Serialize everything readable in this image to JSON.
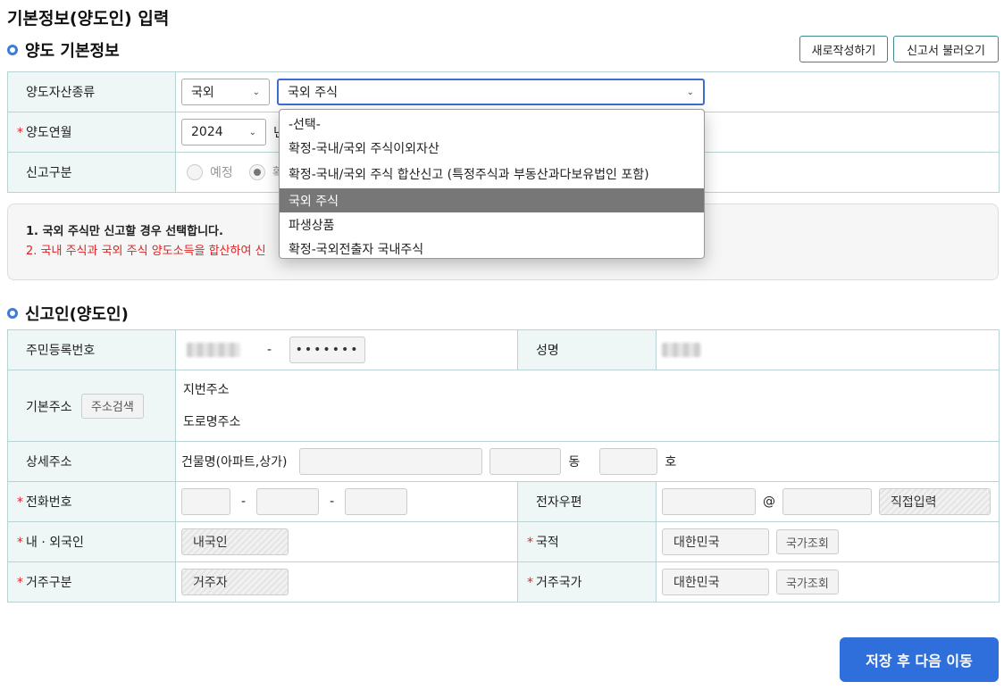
{
  "page_title": "기본정보(양도인) 입력",
  "section1": {
    "title": "양도 기본정보",
    "new_button": "새로작성하기",
    "load_button": "신고서 불러오기",
    "rows": {
      "asset_type_label": "양도자산종류",
      "asset_scope_value": "국외",
      "asset_kind_value": "국외 주식",
      "date_label": "양도연월",
      "year_value": "2024",
      "year_suffix": "년",
      "report_type_label": "신고구분",
      "radio_prelim": "예정",
      "radio_final": "확"
    }
  },
  "dropdown": {
    "options": [
      "-선택-",
      "확정-국내/국외 주식이외자산",
      "확정-국내/국외 주식 합산신고 (특정주식과 부동산과다보유법인 포함)",
      "국외 주식",
      "파생상품",
      "확정-국외전출자 국내주식"
    ],
    "selected_index": 3
  },
  "notice": {
    "line1": "1. 국외 주식만 신고할 경우 선택합니다.",
    "line2_start": "2. 국내 주식과 국외 주식 양도소득을 합산하여 신",
    "line2_end": "."
  },
  "section2": {
    "title": "신고인(양도인)",
    "rrn_label": "주민등록번호",
    "rrn_dash": "-",
    "rrn_masked": "•••••••",
    "name_label": "성명",
    "address_label": "기본주소",
    "address_search_button": "주소검색",
    "lot_address_label": "지번주소",
    "road_address_label": "도로명주소",
    "detail_address_label": "상세주소",
    "building_label": "건물명(아파트,상가)",
    "dong_label": "동",
    "ho_label": "호",
    "phone_label": "전화번호",
    "phone_dash": "-",
    "email_label": "전자우편",
    "email_at": "@",
    "email_domain_select": "직접입력",
    "nationality_type_label": "내 · 외국인",
    "nationality_type_value": "내국인",
    "nationality_label": "국적",
    "nationality_value": "대한민국",
    "country_lookup_button": "국가조회",
    "residence_type_label": "거주구분",
    "residence_type_value": "거주자",
    "residence_country_label": "거주국가",
    "residence_country_value": "대한민국"
  },
  "save_button": "저장 후 다음 이동",
  "colors": {
    "accent": "#2f6fdc",
    "header_bg": "#eef7f6",
    "border": "#b9d3d5",
    "required": "#d9262c"
  }
}
